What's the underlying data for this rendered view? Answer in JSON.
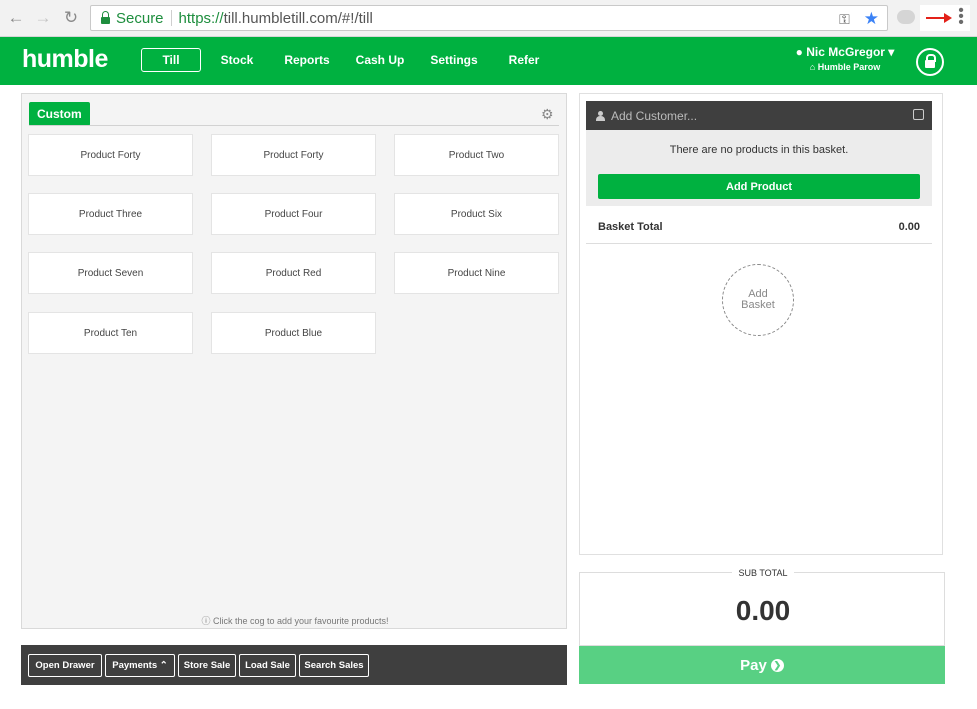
{
  "browser": {
    "secure_label": "Secure",
    "url_scheme": "https://",
    "url_rest": "till.humbletill.com/#!/till",
    "icons": [
      "back-arrow-icon",
      "forward-arrow-icon",
      "reload-icon",
      "lock-icon",
      "key-icon",
      "star-icon",
      "extension-icon",
      "red-arrow-icon",
      "menu-dots-icon"
    ]
  },
  "header": {
    "logo": "humble",
    "nav": [
      "Till",
      "Stock",
      "Reports",
      "Cash Up",
      "Settings",
      "Refer"
    ],
    "active_nav": "Till",
    "user_name": "Nic McGregor",
    "store_name": "Humble Parow"
  },
  "products": {
    "tab_label": "Custom",
    "items": [
      "Product Forty",
      "Product Forty",
      "Product Two",
      "Product Three",
      "Product Four",
      "Product Six",
      "Product Seven",
      "Product Red",
      "Product Nine",
      "Product Ten",
      "Product Blue"
    ],
    "hint": "Click the cog to add your favourite products!"
  },
  "toolbar": {
    "open_drawer": "Open Drawer",
    "payments": "Payments",
    "store_sale": "Store Sale",
    "load_sale": "Load Sale",
    "search_sales": "Search Sales"
  },
  "basket": {
    "customer_placeholder": "Add Customer...",
    "empty_message": "There are no products in this basket.",
    "add_product": "Add Product",
    "total_label": "Basket Total",
    "total_value": "0.00",
    "add_basket_line1": "Add",
    "add_basket_line2": "Basket"
  },
  "summary": {
    "subtotal_label": "SUB TOTAL",
    "subtotal_value": "0.00",
    "pay_label": "Pay"
  },
  "colors": {
    "brand_green": "#00b140",
    "pay_green": "#58d083",
    "dark_bar": "#3f3f3f",
    "annotation_red": "#e32119"
  }
}
